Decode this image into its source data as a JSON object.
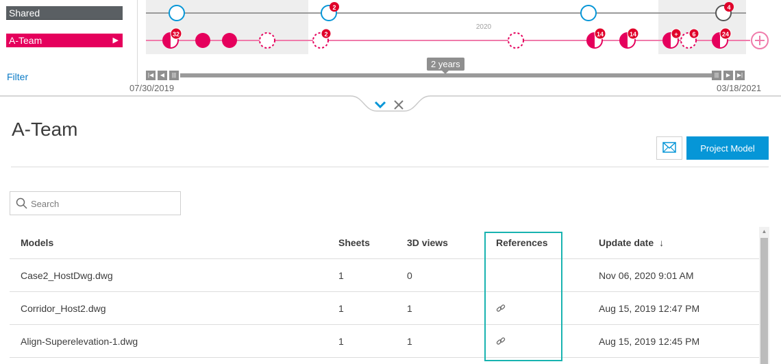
{
  "timeline": {
    "lanes": [
      {
        "label": "Shared"
      },
      {
        "label": "A-Team"
      }
    ],
    "filter_label": "Filter",
    "year_marker": "2020",
    "range_label": "2 years",
    "start_date": "07/30/2019",
    "end_date": "03/18/2021",
    "badges": {
      "shared_a": "2",
      "shared_b": "4",
      "team_a": "32",
      "team_b": "2",
      "team_c": "14",
      "team_d": "14",
      "team_e": "+",
      "team_f": "6",
      "team_g": "24"
    }
  },
  "panel": {
    "title": "A-Team",
    "project_model_label": "Project Model"
  },
  "search": {
    "placeholder": "Search",
    "value": ""
  },
  "table": {
    "headers": {
      "models": "Models",
      "sheets": "Sheets",
      "views": "3D views",
      "references": "References",
      "update_date": "Update date",
      "sort_arrow": "↓"
    },
    "rows": [
      {
        "model": "Case2_HostDwg.dwg",
        "sheets": "1",
        "views": "0",
        "date": "Nov 06, 2020 9:01 AM"
      },
      {
        "model": "Corridor_Host2.dwg",
        "sheets": "1",
        "views": "1",
        "date": "Aug 15, 2019 12:47 PM"
      },
      {
        "model": "Align-Superelevation-1.dwg",
        "sheets": "1",
        "views": "1",
        "date": "Aug 15, 2019 12:45 PM"
      }
    ]
  },
  "colors": {
    "accent_blue": "#0696d7",
    "team_pink": "#e5005c",
    "highlight_teal": "#18b3b0",
    "shared_gray": "#5a5f63"
  },
  "icons": {
    "email": "envelope-icon",
    "search": "search-icon",
    "link": "link-icon",
    "chevron": "chevron-down-icon",
    "close": "close-icon",
    "add": "plus-circle-icon"
  }
}
